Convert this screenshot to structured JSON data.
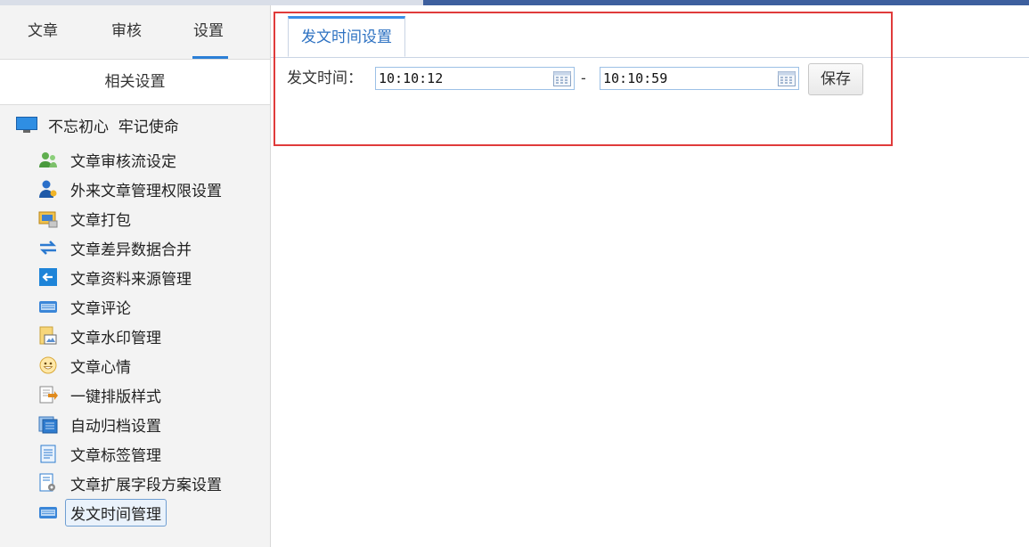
{
  "top_tabs": [
    {
      "label": "文章"
    },
    {
      "label": "审核"
    },
    {
      "label": "设置"
    }
  ],
  "active_top_tab": "设置",
  "section_title": "相关设置",
  "tree": {
    "root_label": "不忘初心  牢记使命",
    "items": [
      {
        "label": "文章审核流设定",
        "icon": "users-icon"
      },
      {
        "label": "外来文章管理权限设置",
        "icon": "user-permission-icon"
      },
      {
        "label": "文章打包",
        "icon": "package-icon"
      },
      {
        "label": "文章差异数据合并",
        "icon": "swap-arrows-icon"
      },
      {
        "label": "文章资料来源管理",
        "icon": "back-arrow-icon"
      },
      {
        "label": "文章评论",
        "icon": "keyboard-icon"
      },
      {
        "label": "文章水印管理",
        "icon": "watermark-icon"
      },
      {
        "label": "文章心情",
        "icon": "smiley-icon"
      },
      {
        "label": "一键排版样式",
        "icon": "document-arrow-icon"
      },
      {
        "label": "自动归档设置",
        "icon": "archive-icon"
      },
      {
        "label": "文章标签管理",
        "icon": "notepad-icon"
      },
      {
        "label": "文章扩展字段方案设置",
        "icon": "document-gear-icon"
      },
      {
        "label": "发文时间管理",
        "icon": "keyboard-icon"
      }
    ],
    "selected": "发文时间管理"
  },
  "content": {
    "tab_label": "发文时间设置",
    "field_label": "发文时间：",
    "start_time": "10:10:12",
    "separator": "-",
    "end_time": "10:10:59",
    "save_label": "保存"
  },
  "colors": {
    "accent": "#2b7fd6",
    "highlight_border": "#e03b3b",
    "tab_text": "#2e72c2"
  }
}
